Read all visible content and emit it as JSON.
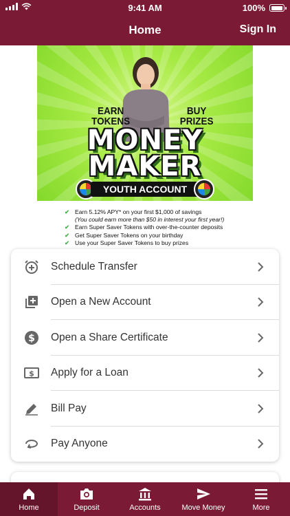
{
  "status": {
    "time": "9:41 AM",
    "battery": "100%"
  },
  "header": {
    "title": "Home",
    "sign_in": "Sign In"
  },
  "promo": {
    "earn": "EARN\nTOKENS",
    "buy": "BUY\nPRIZES",
    "line1": "MONEY",
    "line2": "MAKER",
    "youth": "YOUTH ACCOUNT",
    "benefits": [
      "Earn 5.12% APY* on your first $1,000 of savings",
      "(You could earn more than $50 in interest your first year!)",
      "Earn Super Saver Tokens with over-the-counter deposits",
      "Get Super Saver Tokens on your birthday",
      "Use your Super Saver Tokens to buy prizes"
    ]
  },
  "menu": [
    {
      "label": "Schedule Transfer",
      "icon": "clock-plus-icon"
    },
    {
      "label": "Open a New Account",
      "icon": "add-box-icon"
    },
    {
      "label": "Open a Share Certificate",
      "icon": "dollar-circle-icon"
    },
    {
      "label": "Apply for a Loan",
      "icon": "dollar-bill-icon"
    },
    {
      "label": "Bill Pay",
      "icon": "pencil-icon"
    },
    {
      "label": "Pay Anyone",
      "icon": "pay-anyone-icon"
    }
  ],
  "tabs": [
    {
      "label": "Home",
      "icon": "home-icon"
    },
    {
      "label": "Deposit",
      "icon": "camera-icon"
    },
    {
      "label": "Accounts",
      "icon": "bank-icon"
    },
    {
      "label": "Move Money",
      "icon": "send-icon"
    },
    {
      "label": "More",
      "icon": "menu-icon"
    }
  ],
  "colors": {
    "brand": "#7a1a35",
    "promo_green": "#a7ea45"
  }
}
